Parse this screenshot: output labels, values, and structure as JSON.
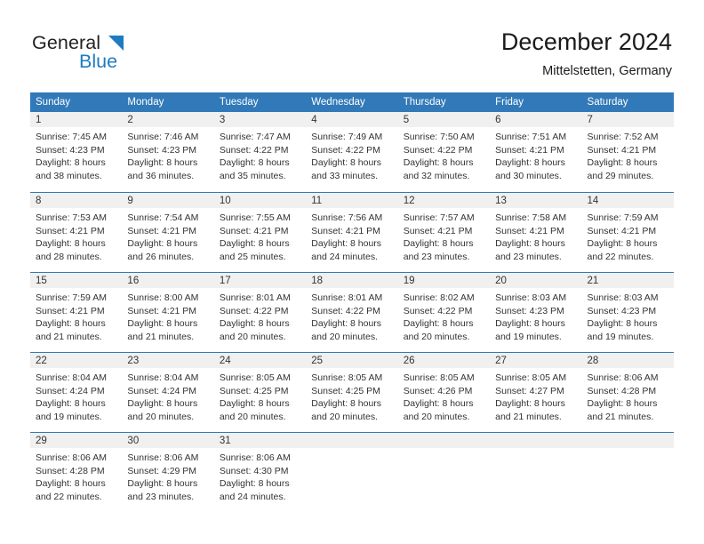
{
  "logo": {
    "primary_text": "General",
    "secondary_text": "Blue",
    "primary_color": "#231f20",
    "secondary_color": "#1f7bc1",
    "triangle_icon": "blue-triangle-icon"
  },
  "header": {
    "month_title": "December 2024",
    "location": "Mittelstetten, Germany"
  },
  "theme": {
    "header_blue": "#3179b8",
    "daynum_band": "#f0f0f0",
    "text": "#333333"
  },
  "calendar": {
    "weekday_headers": [
      "Sunday",
      "Monday",
      "Tuesday",
      "Wednesday",
      "Thursday",
      "Friday",
      "Saturday"
    ],
    "weeks": [
      [
        {
          "day": "1",
          "sunrise": "Sunrise: 7:45 AM",
          "sunset": "Sunset: 4:23 PM",
          "daylight_line1": "Daylight: 8 hours",
          "daylight_line2": "and 38 minutes."
        },
        {
          "day": "2",
          "sunrise": "Sunrise: 7:46 AM",
          "sunset": "Sunset: 4:23 PM",
          "daylight_line1": "Daylight: 8 hours",
          "daylight_line2": "and 36 minutes."
        },
        {
          "day": "3",
          "sunrise": "Sunrise: 7:47 AM",
          "sunset": "Sunset: 4:22 PM",
          "daylight_line1": "Daylight: 8 hours",
          "daylight_line2": "and 35 minutes."
        },
        {
          "day": "4",
          "sunrise": "Sunrise: 7:49 AM",
          "sunset": "Sunset: 4:22 PM",
          "daylight_line1": "Daylight: 8 hours",
          "daylight_line2": "and 33 minutes."
        },
        {
          "day": "5",
          "sunrise": "Sunrise: 7:50 AM",
          "sunset": "Sunset: 4:22 PM",
          "daylight_line1": "Daylight: 8 hours",
          "daylight_line2": "and 32 minutes."
        },
        {
          "day": "6",
          "sunrise": "Sunrise: 7:51 AM",
          "sunset": "Sunset: 4:21 PM",
          "daylight_line1": "Daylight: 8 hours",
          "daylight_line2": "and 30 minutes."
        },
        {
          "day": "7",
          "sunrise": "Sunrise: 7:52 AM",
          "sunset": "Sunset: 4:21 PM",
          "daylight_line1": "Daylight: 8 hours",
          "daylight_line2": "and 29 minutes."
        }
      ],
      [
        {
          "day": "8",
          "sunrise": "Sunrise: 7:53 AM",
          "sunset": "Sunset: 4:21 PM",
          "daylight_line1": "Daylight: 8 hours",
          "daylight_line2": "and 28 minutes."
        },
        {
          "day": "9",
          "sunrise": "Sunrise: 7:54 AM",
          "sunset": "Sunset: 4:21 PM",
          "daylight_line1": "Daylight: 8 hours",
          "daylight_line2": "and 26 minutes."
        },
        {
          "day": "10",
          "sunrise": "Sunrise: 7:55 AM",
          "sunset": "Sunset: 4:21 PM",
          "daylight_line1": "Daylight: 8 hours",
          "daylight_line2": "and 25 minutes."
        },
        {
          "day": "11",
          "sunrise": "Sunrise: 7:56 AM",
          "sunset": "Sunset: 4:21 PM",
          "daylight_line1": "Daylight: 8 hours",
          "daylight_line2": "and 24 minutes."
        },
        {
          "day": "12",
          "sunrise": "Sunrise: 7:57 AM",
          "sunset": "Sunset: 4:21 PM",
          "daylight_line1": "Daylight: 8 hours",
          "daylight_line2": "and 23 minutes."
        },
        {
          "day": "13",
          "sunrise": "Sunrise: 7:58 AM",
          "sunset": "Sunset: 4:21 PM",
          "daylight_line1": "Daylight: 8 hours",
          "daylight_line2": "and 23 minutes."
        },
        {
          "day": "14",
          "sunrise": "Sunrise: 7:59 AM",
          "sunset": "Sunset: 4:21 PM",
          "daylight_line1": "Daylight: 8 hours",
          "daylight_line2": "and 22 minutes."
        }
      ],
      [
        {
          "day": "15",
          "sunrise": "Sunrise: 7:59 AM",
          "sunset": "Sunset: 4:21 PM",
          "daylight_line1": "Daylight: 8 hours",
          "daylight_line2": "and 21 minutes."
        },
        {
          "day": "16",
          "sunrise": "Sunrise: 8:00 AM",
          "sunset": "Sunset: 4:21 PM",
          "daylight_line1": "Daylight: 8 hours",
          "daylight_line2": "and 21 minutes."
        },
        {
          "day": "17",
          "sunrise": "Sunrise: 8:01 AM",
          "sunset": "Sunset: 4:22 PM",
          "daylight_line1": "Daylight: 8 hours",
          "daylight_line2": "and 20 minutes."
        },
        {
          "day": "18",
          "sunrise": "Sunrise: 8:01 AM",
          "sunset": "Sunset: 4:22 PM",
          "daylight_line1": "Daylight: 8 hours",
          "daylight_line2": "and 20 minutes."
        },
        {
          "day": "19",
          "sunrise": "Sunrise: 8:02 AM",
          "sunset": "Sunset: 4:22 PM",
          "daylight_line1": "Daylight: 8 hours",
          "daylight_line2": "and 20 minutes."
        },
        {
          "day": "20",
          "sunrise": "Sunrise: 8:03 AM",
          "sunset": "Sunset: 4:23 PM",
          "daylight_line1": "Daylight: 8 hours",
          "daylight_line2": "and 19 minutes."
        },
        {
          "day": "21",
          "sunrise": "Sunrise: 8:03 AM",
          "sunset": "Sunset: 4:23 PM",
          "daylight_line1": "Daylight: 8 hours",
          "daylight_line2": "and 19 minutes."
        }
      ],
      [
        {
          "day": "22",
          "sunrise": "Sunrise: 8:04 AM",
          "sunset": "Sunset: 4:24 PM",
          "daylight_line1": "Daylight: 8 hours",
          "daylight_line2": "and 19 minutes."
        },
        {
          "day": "23",
          "sunrise": "Sunrise: 8:04 AM",
          "sunset": "Sunset: 4:24 PM",
          "daylight_line1": "Daylight: 8 hours",
          "daylight_line2": "and 20 minutes."
        },
        {
          "day": "24",
          "sunrise": "Sunrise: 8:05 AM",
          "sunset": "Sunset: 4:25 PM",
          "daylight_line1": "Daylight: 8 hours",
          "daylight_line2": "and 20 minutes."
        },
        {
          "day": "25",
          "sunrise": "Sunrise: 8:05 AM",
          "sunset": "Sunset: 4:25 PM",
          "daylight_line1": "Daylight: 8 hours",
          "daylight_line2": "and 20 minutes."
        },
        {
          "day": "26",
          "sunrise": "Sunrise: 8:05 AM",
          "sunset": "Sunset: 4:26 PM",
          "daylight_line1": "Daylight: 8 hours",
          "daylight_line2": "and 20 minutes."
        },
        {
          "day": "27",
          "sunrise": "Sunrise: 8:05 AM",
          "sunset": "Sunset: 4:27 PM",
          "daylight_line1": "Daylight: 8 hours",
          "daylight_line2": "and 21 minutes."
        },
        {
          "day": "28",
          "sunrise": "Sunrise: 8:06 AM",
          "sunset": "Sunset: 4:28 PM",
          "daylight_line1": "Daylight: 8 hours",
          "daylight_line2": "and 21 minutes."
        }
      ],
      [
        {
          "day": "29",
          "sunrise": "Sunrise: 8:06 AM",
          "sunset": "Sunset: 4:28 PM",
          "daylight_line1": "Daylight: 8 hours",
          "daylight_line2": "and 22 minutes."
        },
        {
          "day": "30",
          "sunrise": "Sunrise: 8:06 AM",
          "sunset": "Sunset: 4:29 PM",
          "daylight_line1": "Daylight: 8 hours",
          "daylight_line2": "and 23 minutes."
        },
        {
          "day": "31",
          "sunrise": "Sunrise: 8:06 AM",
          "sunset": "Sunset: 4:30 PM",
          "daylight_line1": "Daylight: 8 hours",
          "daylight_line2": "and 24 minutes."
        },
        {
          "day": "",
          "sunrise": "",
          "sunset": "",
          "daylight_line1": "",
          "daylight_line2": ""
        },
        {
          "day": "",
          "sunrise": "",
          "sunset": "",
          "daylight_line1": "",
          "daylight_line2": ""
        },
        {
          "day": "",
          "sunrise": "",
          "sunset": "",
          "daylight_line1": "",
          "daylight_line2": ""
        },
        {
          "day": "",
          "sunrise": "",
          "sunset": "",
          "daylight_line1": "",
          "daylight_line2": ""
        }
      ]
    ]
  }
}
